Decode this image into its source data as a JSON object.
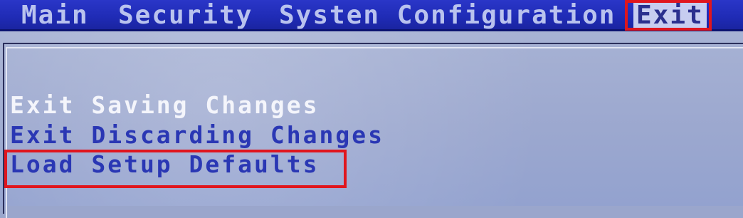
{
  "menubar": {
    "items": [
      {
        "label": "Main"
      },
      {
        "label": "Security"
      },
      {
        "label": "Systen Configuration"
      },
      {
        "label": "Exit"
      }
    ]
  },
  "exit_menu": {
    "options": [
      {
        "label": "Exit Saving Changes"
      },
      {
        "label": "Exit Discarding Changes"
      },
      {
        "label": "Load Setup Defaults"
      }
    ]
  },
  "colors": {
    "menubar_bg": "#1f2bb5",
    "menu_text": "#b9c2ee",
    "panel_bg": "#9ca8cf",
    "option_text": "#2a37b4",
    "selected_option_text": "#f4f5fb",
    "highlight_box": "#e0161e"
  }
}
